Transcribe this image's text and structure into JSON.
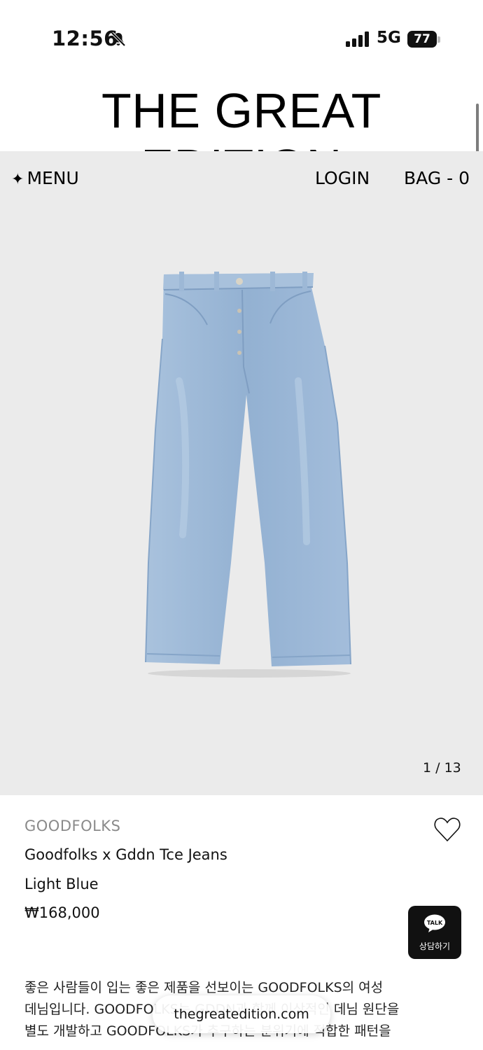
{
  "status": {
    "time": "12:56",
    "network": "5G",
    "battery": "77"
  },
  "header": {
    "brand": "THE GREAT EDITION"
  },
  "nav": {
    "menu_label": "MENU",
    "login_label": "LOGIN",
    "bag_label": "BAG - 0"
  },
  "gallery": {
    "image_label": "jeans-product-image",
    "pager": "1 / 13"
  },
  "product": {
    "brand": "GOODFOLKS",
    "name": "Goodfolks x Gddn Tce Jeans",
    "color": "Light Blue",
    "price": "₩168,000"
  },
  "chat": {
    "bubble_text": "TALK",
    "label": "상담하기"
  },
  "description": {
    "lines": [
      "좋은 사람들이 입는 좋은 제품을 선보이는 GOODFOLKS의 여성",
      "데님입니다. GOODFOLKS는 GDDN과 함께 이상적인 데님 원단을",
      "별도 개발하고 GOODFOLKS가 추구하는 분위기에 적합한 패턴을"
    ]
  },
  "browser": {
    "url": "thegreatedition.com"
  },
  "colors": {
    "gallery_bg": "#ebebeb",
    "denim": "#9ab7d6",
    "brand_grey": "#8a8a8a"
  }
}
